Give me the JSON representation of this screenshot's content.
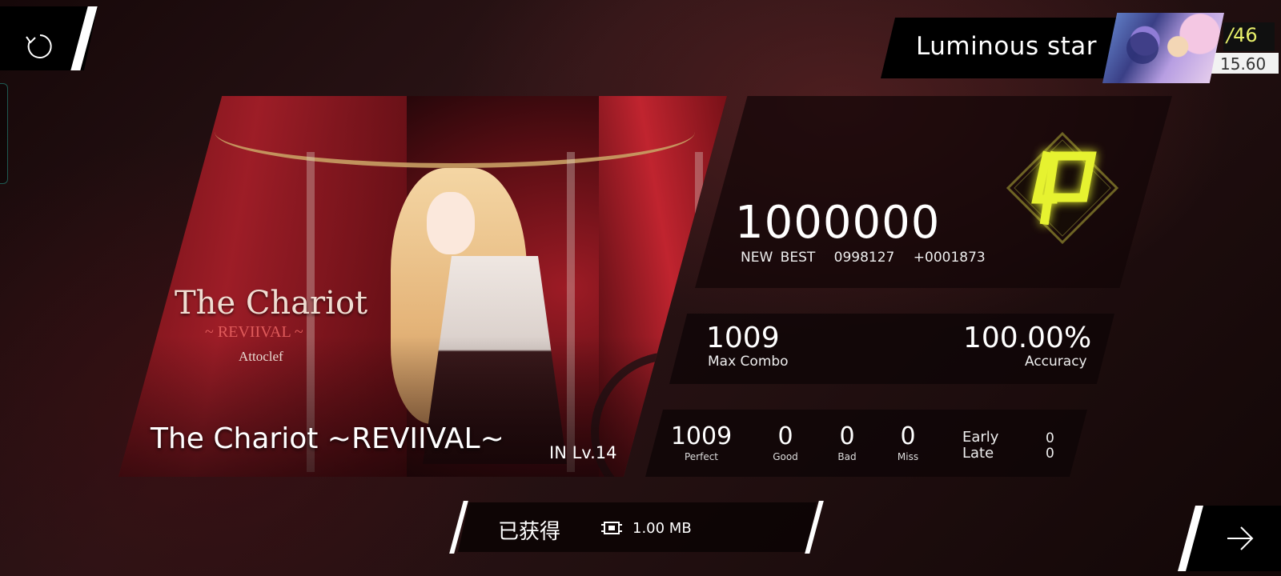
{
  "player": {
    "name": "Luminous star",
    "level": "46",
    "rks": "15.60"
  },
  "song": {
    "art_title": "The Chariot",
    "art_subtitle": "~ REVIIVAL ~",
    "art_composer": "Attoclef",
    "title": "The Chariot ~REVIIVAL~",
    "difficulty": "IN  Lv.14"
  },
  "score": {
    "value": "1000000",
    "new_best_label": "NEW BEST",
    "previous_best": "0998127",
    "delta": "+0001873",
    "grade_icon": "phi-grade-icon",
    "grade_color": "#e6f230"
  },
  "stats": {
    "max_combo": "1009",
    "max_combo_label": "Max Combo",
    "accuracy": "100.00%",
    "accuracy_label": "Accuracy"
  },
  "judgements": {
    "perfect": "1009",
    "perfect_label": "Perfect",
    "good": "0",
    "good_label": "Good",
    "bad": "0",
    "bad_label": "Bad",
    "miss": "0",
    "miss_label": "Miss",
    "early_label": "Early",
    "early": "0",
    "late_label": "Late",
    "late": "0"
  },
  "download": {
    "status": "已获得",
    "size": "1.00 MB",
    "icon": "chip-icon"
  },
  "controls": {
    "retry_icon": "retry-icon",
    "next_icon": "arrow-right-icon"
  }
}
